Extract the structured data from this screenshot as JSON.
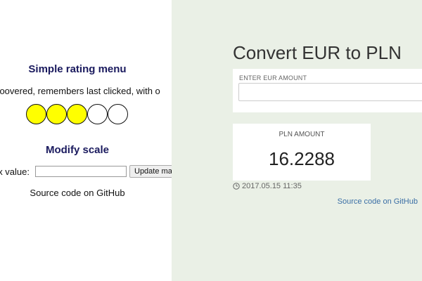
{
  "rating_demo": {
    "title": "Simple rating menu",
    "description": "hoovered, remembers last clicked, with o",
    "rating": {
      "filled": 3,
      "total": 5
    },
    "filled_color": "#ffff00",
    "empty_color": "#ffffff",
    "scale": {
      "title": "Modify scale",
      "label": "x value:",
      "input_value": "",
      "button_label": "Update max"
    },
    "source_link": "Source code on GitHub"
  },
  "converter": {
    "title": "Convert EUR to PLN",
    "eur_field": {
      "label": "ENTER EUR AMOUNT",
      "value": ""
    },
    "pln_card": {
      "label": "PLN AMOUNT",
      "value": "16.2288"
    },
    "timestamp": "2017.05.15 11:35",
    "timestamp_icon": "clock-icon",
    "source_link": "Source code on GitHub",
    "background_color": "#eaf0e6",
    "link_color": "#3a6ea5"
  }
}
